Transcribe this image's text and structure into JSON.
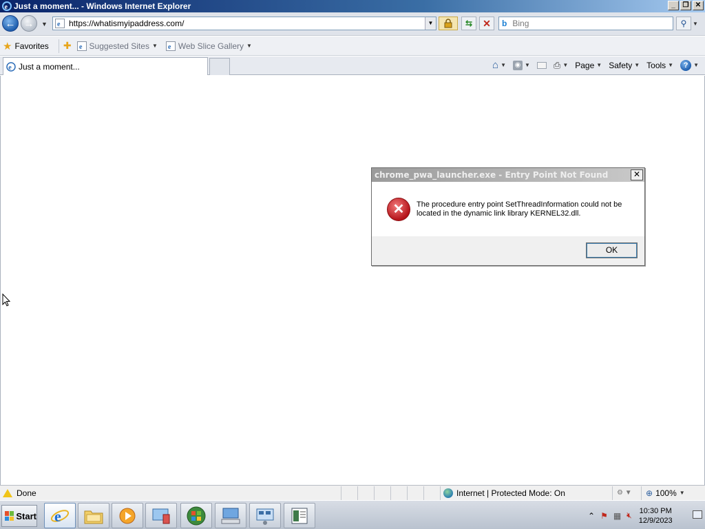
{
  "window": {
    "title": "Just a moment... - Windows Internet Explorer",
    "buttons": [
      "_",
      "❐",
      "✕"
    ]
  },
  "address_bar": {
    "url": "https://whatismyipaddress.com/",
    "search_placeholder": "Bing"
  },
  "favorites_bar": {
    "favorites_label": "Favorites",
    "items": [
      {
        "label": "Suggested Sites"
      },
      {
        "label": "Web Slice Gallery"
      }
    ]
  },
  "tabs": [
    {
      "label": "Just a moment..."
    }
  ],
  "command_bar": {
    "page_label": "Page",
    "safety_label": "Safety",
    "tools_label": "Tools"
  },
  "dialog": {
    "title": "chrome_pwa_launcher.exe - Entry Point Not Found",
    "message": "The procedure entry point SetThreadInformation could not be located in the dynamic link library KERNEL32.dll.",
    "ok_label": "OK",
    "icon": "error-icon"
  },
  "status_bar": {
    "status_text": "Done",
    "zone_text": "Internet | Protected Mode: On",
    "zoom_text": "100%"
  },
  "taskbar": {
    "start_label": "Start",
    "clock_time": "10:30 PM",
    "clock_date": "12/9/2023"
  },
  "colors": {
    "title_bar": "#0a246a",
    "error_red": "#b5141a",
    "dialog_title_inactive": "#9b9b9b"
  }
}
